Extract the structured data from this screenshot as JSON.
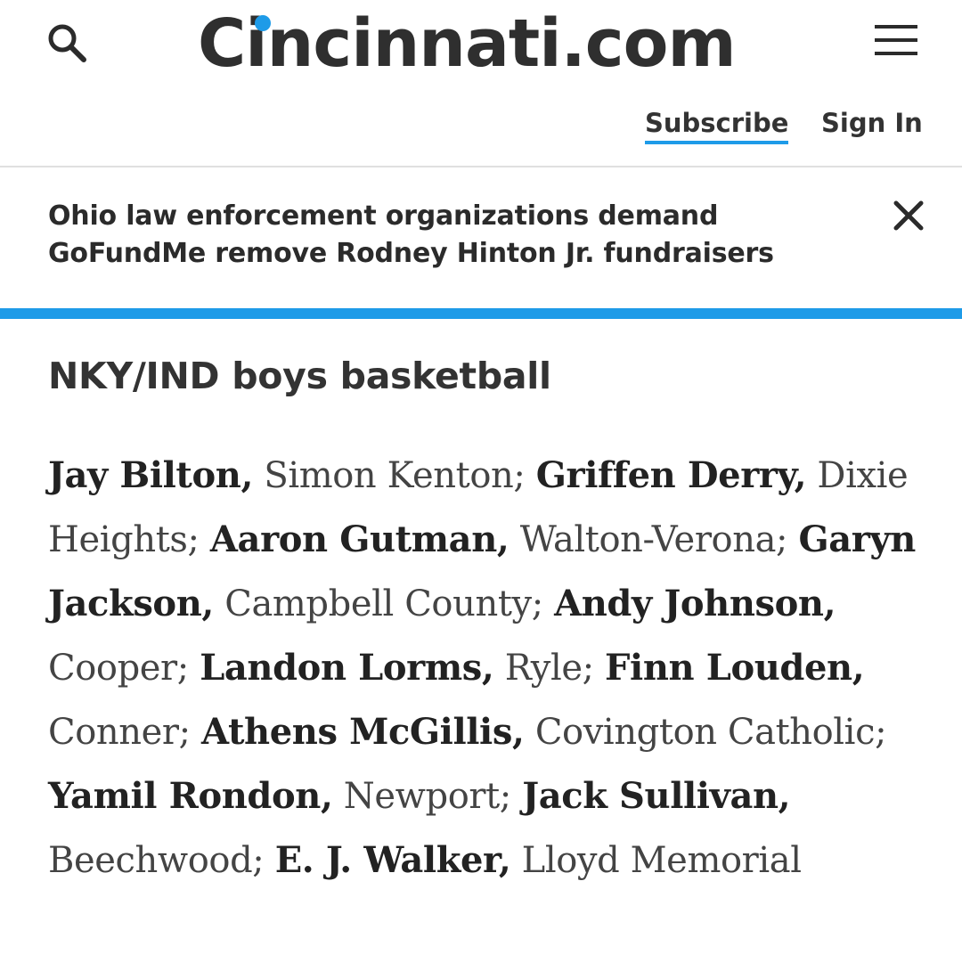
{
  "header": {
    "logo_text": "Cincinnati.com",
    "subscribe_label": "Subscribe",
    "signin_label": "Sign In",
    "search_icon": "search-icon",
    "menu_icon": "hamburger-menu-icon",
    "accent_color": "#1e9be8"
  },
  "alert": {
    "text": "Ohio law enforcement organizations demand GoFundMe remove Rodney Hinton Jr. fundraisers",
    "close_icon": "close-icon"
  },
  "article": {
    "section_title": "NKY/IND boys basketball",
    "players": [
      {
        "name": "Jay Bilton,",
        "school": "Simon Kenton;"
      },
      {
        "name": "Griffen Derry,",
        "school": "Dixie Heights;"
      },
      {
        "name": "Aaron Gutman,",
        "school": "Walton-Verona;"
      },
      {
        "name": "Garyn Jackson,",
        "school": "Campbell County;"
      },
      {
        "name": "Andy Johnson,",
        "school": "Cooper;"
      },
      {
        "name": "Landon Lorms,",
        "school": "Ryle;"
      },
      {
        "name": "Finn Louden,",
        "school": "Conner;"
      },
      {
        "name": "Athens McGillis,",
        "school": "Covington Catholic;"
      },
      {
        "name": "Yamil Rondon,",
        "school": "Newport;"
      },
      {
        "name": "Jack Sullivan,",
        "school": "Beechwood;"
      },
      {
        "name": "E. J. Walker,",
        "school": "Lloyd Memorial"
      }
    ]
  }
}
